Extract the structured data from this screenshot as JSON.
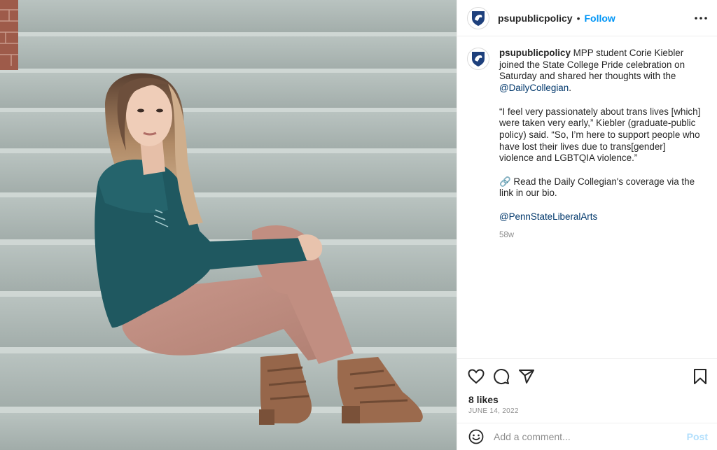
{
  "post": {
    "username": "psupublicpolicy",
    "separator": "•",
    "follow_label": "Follow",
    "photo_alt": "Woman in a green sweatshirt and pink trousers sitting on concrete steps",
    "caption": {
      "username": "psupublicpolicy",
      "line1": " MPP student Corie Kiebler joined the State College Pride celebration on Saturday and shared her thoughts with the ",
      "mention1": "@DailyCollegian",
      "line1_end": ".",
      "quote": "“I feel very passionately about trans lives [which] were taken very early,” Kiebler (graduate-public policy) said. “So, I’m here to support people who have lost their lives due to trans[gender] violence and LGBTQIA violence.”",
      "link_emoji": "🔗",
      "link_text": " Read the Daily Collegian's coverage via the link in our bio.",
      "mention2": "@PennStateLiberalArts",
      "age": "58w"
    },
    "likes": "8 likes",
    "date": "JUNE 14, 2022"
  },
  "comment_box": {
    "placeholder": "Add a comment...",
    "post_label": "Post"
  },
  "icons": {
    "avatar": "penn-state-shield-icon",
    "more": "more-options-icon",
    "like": "heart-icon",
    "comment": "comment-bubble-icon",
    "share": "paper-plane-icon",
    "save": "bookmark-icon",
    "emoji": "emoji-smile-icon"
  },
  "colors": {
    "accent": "#0095f6",
    "mention": "#00376b",
    "muted": "#8e8e8e",
    "post_disabled": "#b2dffc",
    "shield_navy": "#1e407c"
  }
}
